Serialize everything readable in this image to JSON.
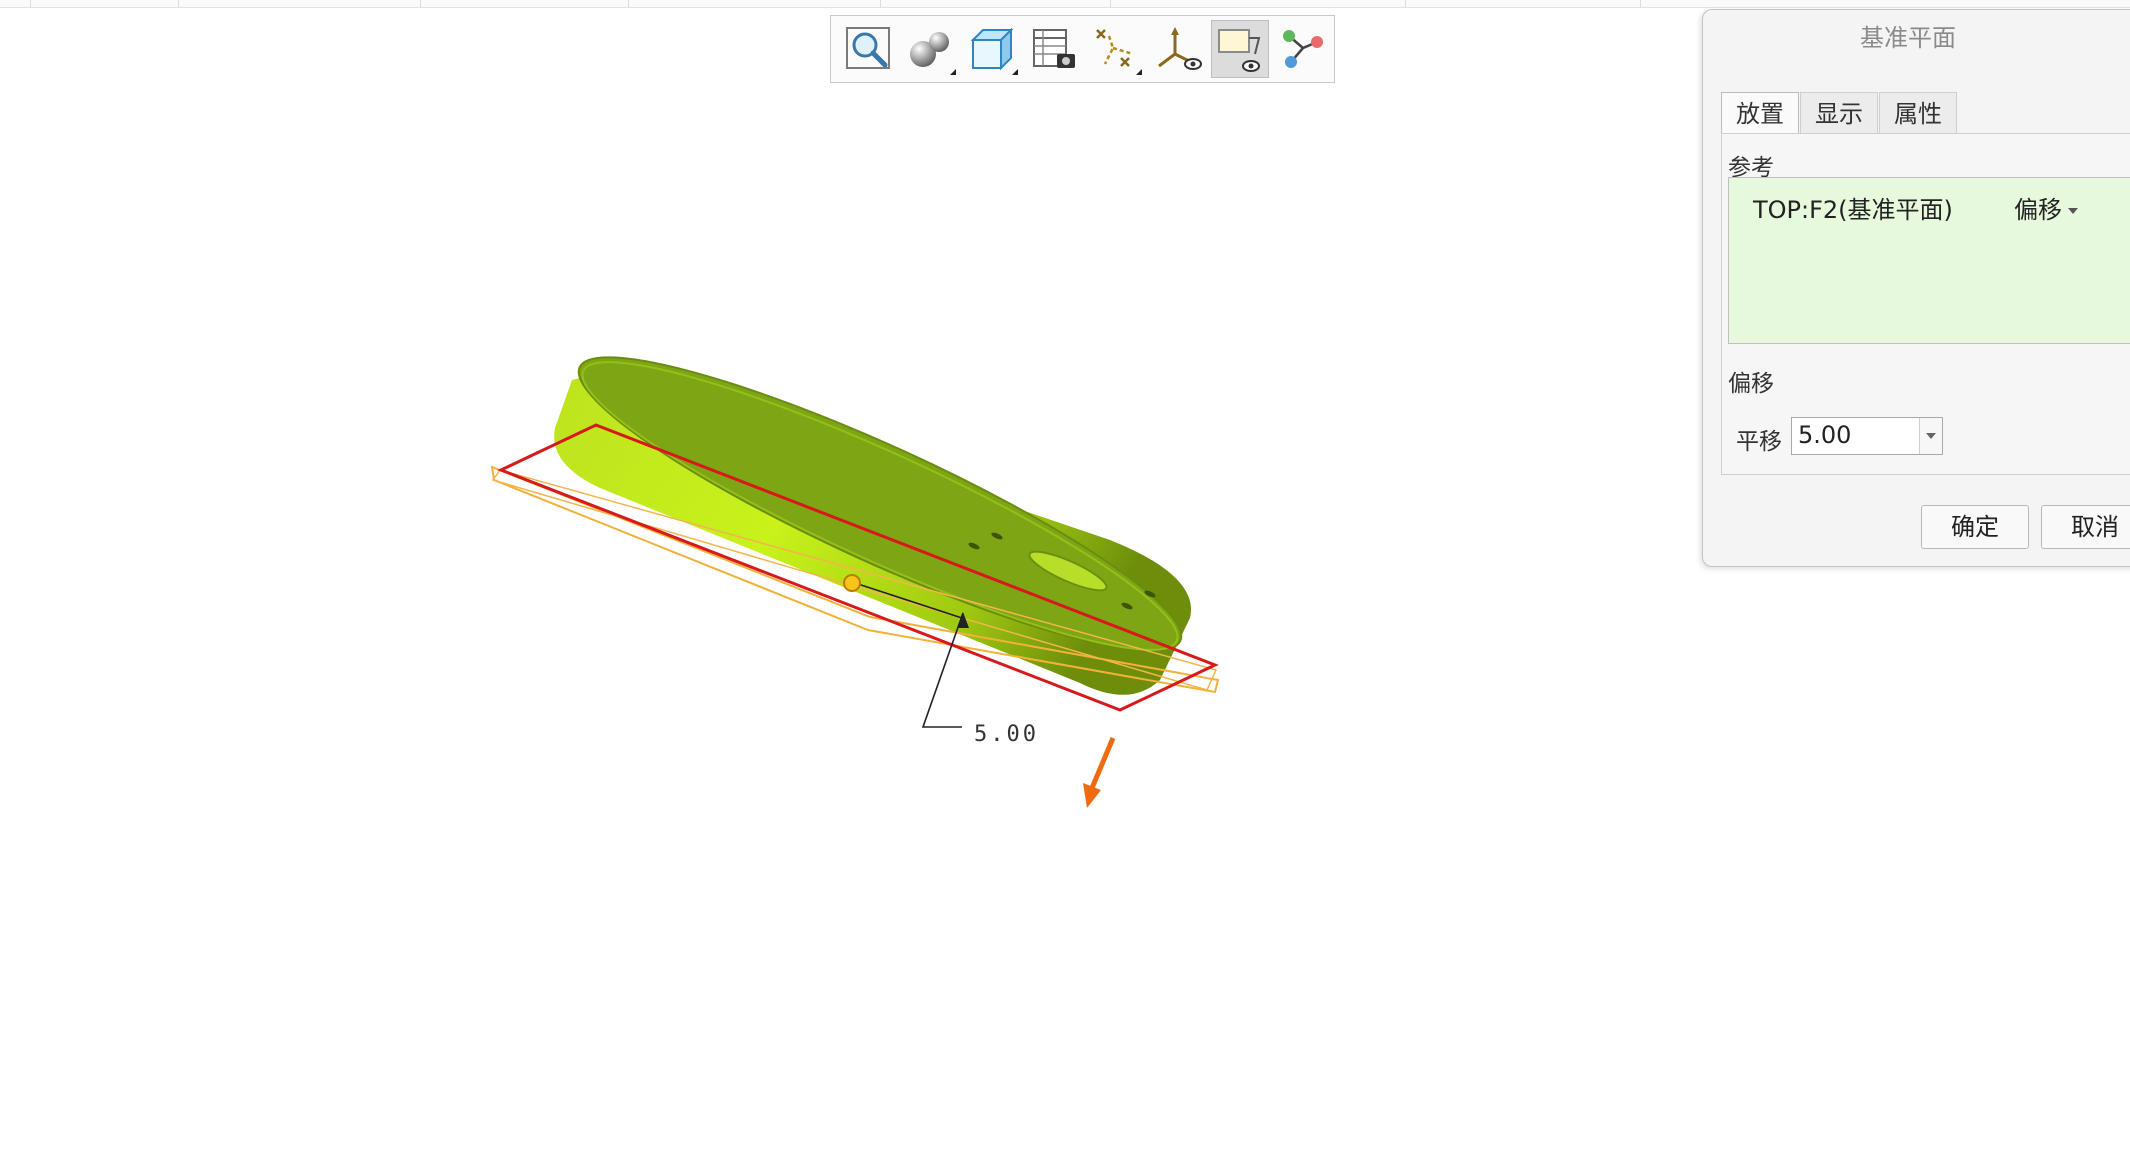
{
  "toolbar": {
    "buttons": [
      {
        "name": "refit-zoom-icon",
        "active": false
      },
      {
        "name": "view-manager-icon",
        "active": false
      },
      {
        "name": "display-style-icon",
        "active": false
      },
      {
        "name": "saved-views-icon",
        "active": false
      },
      {
        "name": "datum-display-filter-icon",
        "active": false
      },
      {
        "name": "csys-display-icon",
        "active": false
      },
      {
        "name": "annotation-display-icon",
        "active": true
      },
      {
        "name": "spin-center-icon",
        "active": false
      }
    ]
  },
  "viewport": {
    "dimension_value": "5.00",
    "model_color": "#a6d616",
    "plane_color": "#d7191c",
    "offset_arrow_color": "#f06a0f"
  },
  "dialog": {
    "title": "基准平面",
    "tabs": [
      "放置",
      "显示",
      "属性"
    ],
    "active_tab": "放置",
    "references_label": "参考",
    "reference": {
      "name": "TOP:F2(基准平面)",
      "type": "偏移"
    },
    "offset_section_label": "偏移",
    "translation_label": "平移",
    "translation_value": "5.00",
    "ok_label": "确定",
    "cancel_label": "取消"
  }
}
